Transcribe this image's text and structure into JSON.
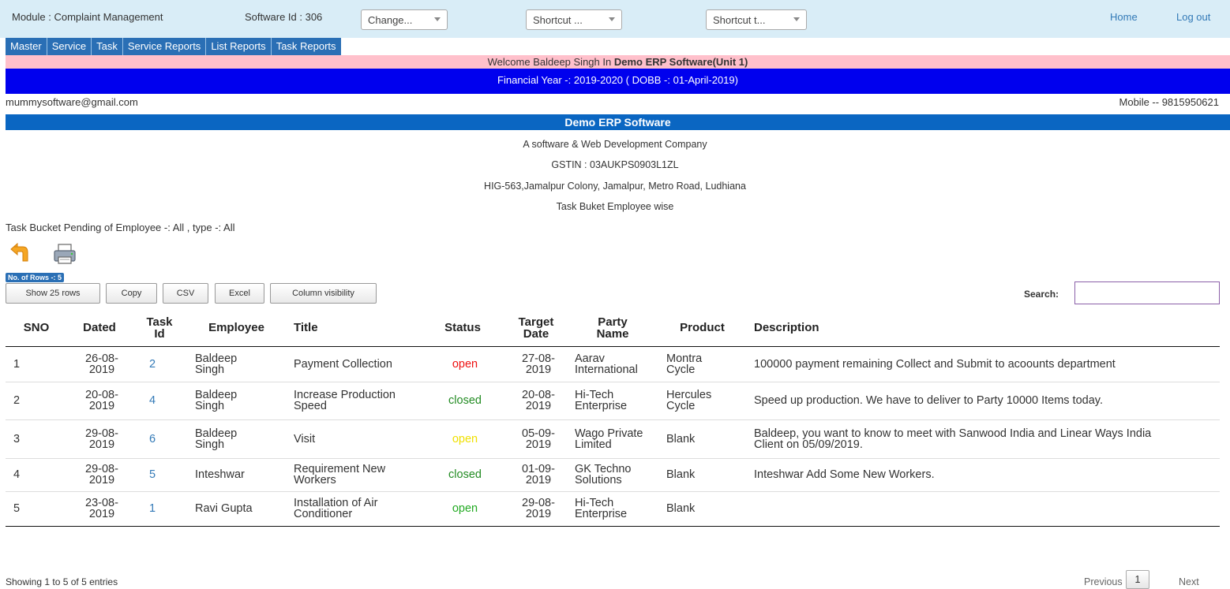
{
  "header": {
    "module": "Module : Complaint Management",
    "software_id": "Software Id : 306",
    "select_change": "Change...",
    "select_shortcut1": "Shortcut ...",
    "select_shortcut2": "Shortcut t...",
    "home": "Home",
    "logout": "Log out"
  },
  "menu": [
    "Master",
    "Service",
    "Task",
    "Service Reports",
    "List Reports",
    "Task Reports"
  ],
  "welcome": {
    "prefix": "Welcome Baldeep Singh In ",
    "bold": "Demo ERP Software(Unit 1)"
  },
  "financial_year": "Financial Year -: 2019-2020 ( DOBB -: 01-April-2019)",
  "email": "mummysoftware@gmail.com",
  "mobile": "Mobile -- 9815950621",
  "company": {
    "name": "Demo ERP Software",
    "tagline": "A software & Web Development Company",
    "gstin": "GSTIN : 03AUKPS0903L1ZL",
    "address": "HIG-563,Jamalpur Colony, Jamalpur, Metro Road, Ludhiana",
    "report_title": "Task Buket Employee wise"
  },
  "pending_text": "Task Bucket Pending of Employee -: All , type -: All",
  "icons": {
    "back": "back-arrow-icon",
    "print": "printer-icon"
  },
  "rows_badge": "No. of Rows -: 5",
  "toolbar": {
    "show_rows": "Show 25 rows",
    "copy": "Copy",
    "csv": "CSV",
    "excel": "Excel",
    "column_visibility": "Column visibility"
  },
  "search_label": "Search:",
  "table": {
    "columns": [
      "SNO",
      "Dated",
      "Task Id",
      "Employee",
      "Title",
      "Status",
      "Target Date",
      "Party Name",
      "Product",
      "Description"
    ],
    "rows": [
      {
        "sno": "1",
        "dated": "26-08-2019",
        "task_id": "2",
        "employee": "Baldeep Singh",
        "title": "Payment Collection",
        "status": "open",
        "status_color": "#ee1111",
        "target": "27-08-2019",
        "party": "Aarav International",
        "product": "Montra Cycle",
        "description": "100000 payment remaining Collect and Submit to acoounts department"
      },
      {
        "sno": "2",
        "dated": "20-08-2019",
        "task_id": "4",
        "employee": "Baldeep Singh",
        "title": "Increase Production Speed",
        "status": "closed",
        "status_color": "#228b22",
        "target": "20-08-2019",
        "party": "Hi-Tech Enterprise",
        "product": "Hercules Cycle",
        "description": "Speed up production. We have to deliver to Party 10000 Items today."
      },
      {
        "sno": "3",
        "dated": "29-08-2019",
        "task_id": "6",
        "employee": "Baldeep Singh",
        "title": "Visit",
        "status": "open",
        "status_color": "#f0e000",
        "target": "05-09-2019",
        "party": "Wago Private Limited",
        "product": "Blank",
        "description": "Baldeep, you want to know to meet with Sanwood India and Linear Ways India Client on 05/09/2019."
      },
      {
        "sno": "4",
        "dated": "29-08-2019",
        "task_id": "5",
        "employee": "Inteshwar",
        "title": "Requirement New Workers",
        "status": "closed",
        "status_color": "#228b22",
        "target": "01-09-2019",
        "party": "GK Techno Solutions",
        "product": "Blank",
        "description": "Inteshwar Add Some New Workers."
      },
      {
        "sno": "5",
        "dated": "23-08-2019",
        "task_id": "1",
        "employee": "Ravi Gupta",
        "title": "Installation of Air Conditioner",
        "status": "open",
        "status_color": "#22aa22",
        "target": "29-08-2019",
        "party": "Hi-Tech Enterprise",
        "product": "Blank",
        "description": ""
      }
    ]
  },
  "footer": {
    "info": "Showing 1 to 5 of 5 entries",
    "previous": "Previous",
    "page": "1",
    "next": "Next"
  }
}
